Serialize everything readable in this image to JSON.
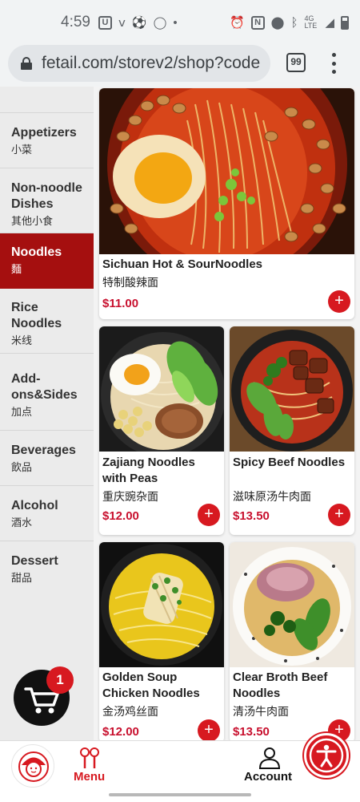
{
  "status_bar": {
    "time": "4:59",
    "network": "4G LTE"
  },
  "browser": {
    "url": "fetail.com/storev2/shop?code",
    "tab_count": "99"
  },
  "sidebar": {
    "items": [
      {
        "en": "Appetizers",
        "zh": "小菜",
        "active": false
      },
      {
        "en": "Non-noodle Dishes",
        "zh": "其他小食",
        "active": false
      },
      {
        "en": "Noodles",
        "zh": "麵",
        "active": true
      },
      {
        "en": "Rice Noodles",
        "zh": "米线",
        "active": false
      },
      {
        "en": "Add-ons&Sides",
        "zh": "加点",
        "active": false
      },
      {
        "en": "Beverages",
        "zh": "飲品",
        "active": false
      },
      {
        "en": "Alcohol",
        "zh": "酒水",
        "active": false
      },
      {
        "en": "Dessert",
        "zh": "甜品",
        "active": false
      }
    ]
  },
  "menu_items": [
    {
      "name": "Sichuan Hot & SourNoodles",
      "zh": "特制酸辣面",
      "price": "$11.00"
    },
    {
      "name": "Zajiang Noodles with Peas",
      "zh": "重庆豌杂面",
      "price": "$12.00"
    },
    {
      "name": "Spicy Beef Noodles",
      "zh": "滋味原汤牛肉面",
      "price": "$13.50"
    },
    {
      "name": "Golden Soup Chicken Noodles",
      "zh": "金汤鸡丝面",
      "price": "$12.00"
    },
    {
      "name": "Clear Broth Beef Noodles",
      "zh": "清汤牛肉面",
      "price": "$13.50"
    }
  ],
  "add_label": "+",
  "cart": {
    "count": "1"
  },
  "bottom_nav": {
    "menu_label": "Menu",
    "account_label": "Account"
  },
  "colors": {
    "accent": "#d71920",
    "active_category": "#a50f0f",
    "price": "#c8102e"
  },
  "icons": [
    "lock-icon",
    "cart-icon",
    "accessibility-icon",
    "menu-utensils-icon",
    "account-person-icon",
    "more-vert-icon"
  ]
}
